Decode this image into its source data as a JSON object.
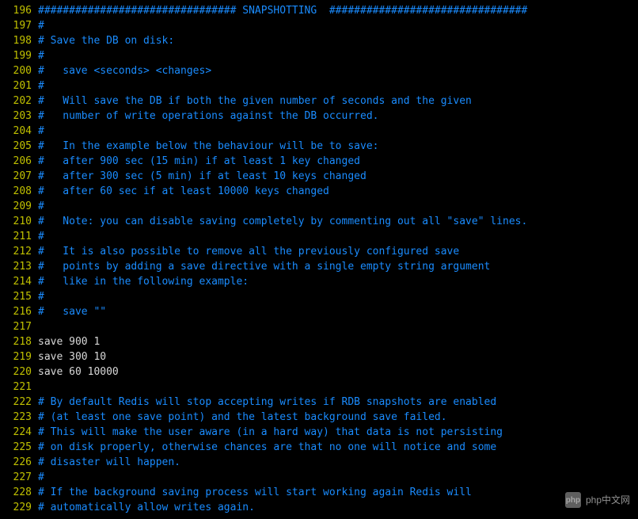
{
  "lines": [
    {
      "n": 196,
      "cls": "comment",
      "t": "################################ SNAPSHOTTING  ################################"
    },
    {
      "n": 197,
      "cls": "comment",
      "t": "#"
    },
    {
      "n": 198,
      "cls": "comment",
      "t": "# Save the DB on disk:"
    },
    {
      "n": 199,
      "cls": "comment",
      "t": "#"
    },
    {
      "n": 200,
      "cls": "comment",
      "t": "#   save <seconds> <changes>"
    },
    {
      "n": 201,
      "cls": "comment",
      "t": "#"
    },
    {
      "n": 202,
      "cls": "comment",
      "t": "#   Will save the DB if both the given number of seconds and the given"
    },
    {
      "n": 203,
      "cls": "comment",
      "t": "#   number of write operations against the DB occurred."
    },
    {
      "n": 204,
      "cls": "comment",
      "t": "#"
    },
    {
      "n": 205,
      "cls": "comment",
      "t": "#   In the example below the behaviour will be to save:"
    },
    {
      "n": 206,
      "cls": "comment",
      "t": "#   after 900 sec (15 min) if at least 1 key changed"
    },
    {
      "n": 207,
      "cls": "comment",
      "t": "#   after 300 sec (5 min) if at least 10 keys changed"
    },
    {
      "n": 208,
      "cls": "comment",
      "t": "#   after 60 sec if at least 10000 keys changed"
    },
    {
      "n": 209,
      "cls": "comment",
      "t": "#"
    },
    {
      "n": 210,
      "cls": "comment",
      "t": "#   Note: you can disable saving completely by commenting out all \"save\" lines."
    },
    {
      "n": 211,
      "cls": "comment",
      "t": "#"
    },
    {
      "n": 212,
      "cls": "comment",
      "t": "#   It is also possible to remove all the previously configured save"
    },
    {
      "n": 213,
      "cls": "comment",
      "t": "#   points by adding a save directive with a single empty string argument"
    },
    {
      "n": 214,
      "cls": "comment",
      "t": "#   like in the following example:"
    },
    {
      "n": 215,
      "cls": "comment",
      "t": "#"
    },
    {
      "n": 216,
      "cls": "comment",
      "t": "#   save \"\""
    },
    {
      "n": 217,
      "cls": "plain",
      "t": ""
    },
    {
      "n": 218,
      "cls": "plain",
      "t": "save 900 1"
    },
    {
      "n": 219,
      "cls": "plain",
      "t": "save 300 10"
    },
    {
      "n": 220,
      "cls": "plain",
      "t": "save 60 10000"
    },
    {
      "n": 221,
      "cls": "plain",
      "t": ""
    },
    {
      "n": 222,
      "cls": "comment",
      "t": "# By default Redis will stop accepting writes if RDB snapshots are enabled"
    },
    {
      "n": 223,
      "cls": "comment",
      "t": "# (at least one save point) and the latest background save failed."
    },
    {
      "n": 224,
      "cls": "comment",
      "t": "# This will make the user aware (in a hard way) that data is not persisting"
    },
    {
      "n": 225,
      "cls": "comment",
      "t": "# on disk properly, otherwise chances are that no one will notice and some"
    },
    {
      "n": 226,
      "cls": "comment",
      "t": "# disaster will happen."
    },
    {
      "n": 227,
      "cls": "comment",
      "t": "#"
    },
    {
      "n": 228,
      "cls": "comment",
      "t": "# If the background saving process will start working again Redis will"
    },
    {
      "n": 229,
      "cls": "comment",
      "t": "# automatically allow writes again."
    }
  ],
  "watermark": {
    "logo": "php",
    "text": "php中文网"
  }
}
